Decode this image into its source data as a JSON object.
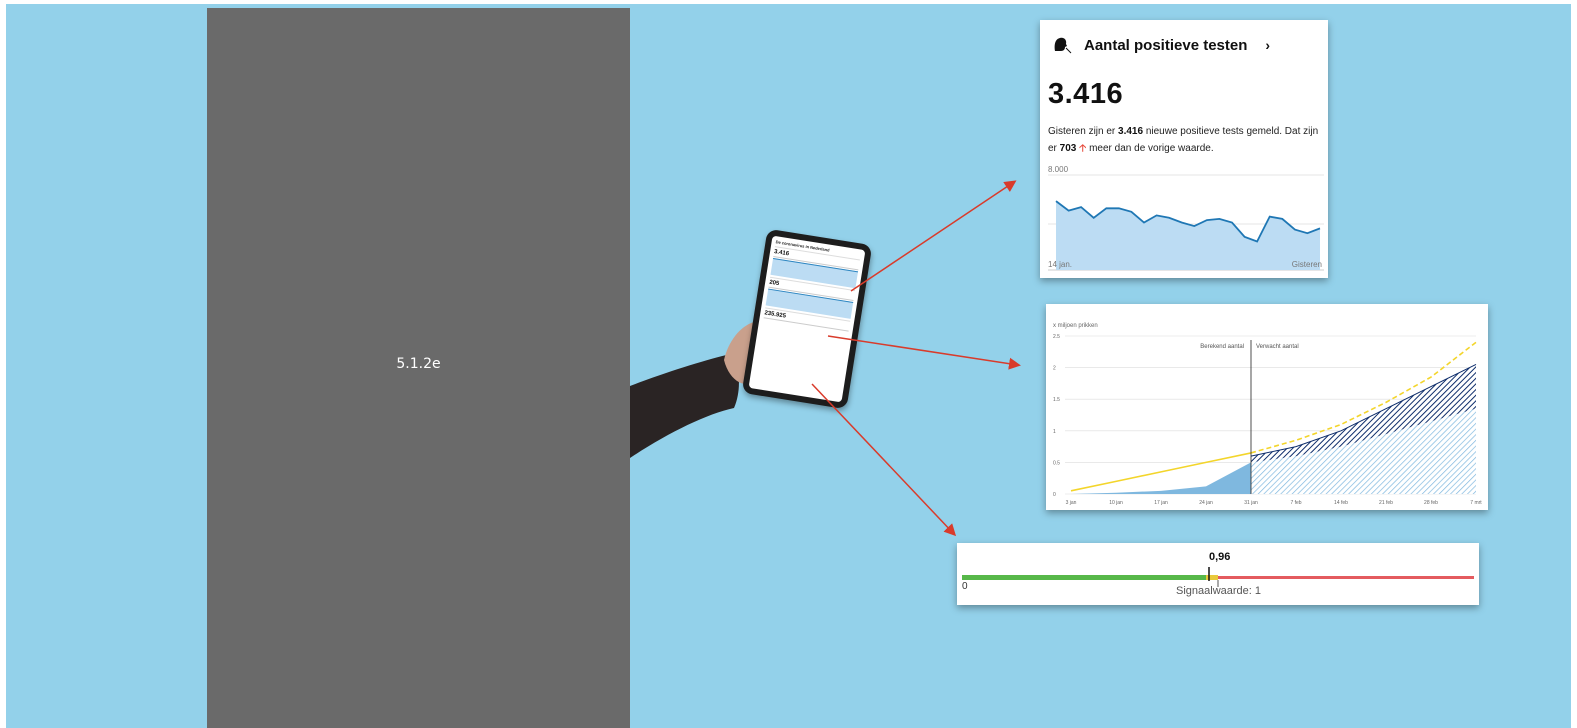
{
  "placeholder": {
    "label": "5.1.2e"
  },
  "tablet": {
    "title": "De coronavirus in Nederland",
    "section1_value": "3.416",
    "section2_value": "205",
    "section3_value": "235.925"
  },
  "card_positive_tests": {
    "icon": "person-coughing-icon",
    "title": "Aantal positieve testen",
    "chevron": "›",
    "value": "3.416",
    "desc_pre": "Gisteren zijn er ",
    "desc_value": "3.416",
    "desc_mid": " nieuwe positieve tests gemeld. Dat zijn er ",
    "desc_diff": "703",
    "desc_post": " meer dan de vorige waarde.",
    "arrow_color": "#e64b3c",
    "chart_data": {
      "type": "area",
      "title": "",
      "ytick": "8.000",
      "x_start_label": "14 jan.",
      "x_end_label": "Gisteren",
      "ylim": [
        0,
        8000
      ],
      "values": [
        5800,
        5000,
        5300,
        4400,
        5200,
        5200,
        4900,
        4000,
        4600,
        4400,
        4000,
        3700,
        4200,
        4300,
        4000,
        2800,
        2400,
        4500,
        4300,
        3400,
        3100,
        3500
      ],
      "line_color": "#1f77b4",
      "fill_color": "#bcdcf3"
    }
  },
  "card_vaccinations": {
    "ylabel": "x miljoen prikken",
    "label_calculated": "Berekend aantal",
    "label_expected": "Verwacht aantal",
    "chart_data": {
      "type": "line",
      "ylabel": "x miljoen prikken",
      "yticks": [
        "0",
        "0.5",
        "1",
        "1.5",
        "2",
        "2.5"
      ],
      "ylim": [
        0,
        2.5
      ],
      "xticks": [
        "3 jan",
        "10 jan",
        "17 jan",
        "24 jan",
        "31 jan",
        "7 feb",
        "14 feb",
        "21 feb",
        "28 feb",
        "7 mrt"
      ],
      "series": [
        {
          "name": "",
          "values": [
            0.05,
            0.2,
            0.35,
            0.5,
            0.65,
            0.85,
            1.1,
            1.45,
            1.85,
            2.4
          ]
        },
        {
          "name": "",
          "values": [
            0.0,
            0.03,
            0.07,
            0.15,
            0.6,
            0.75,
            1.0,
            1.35,
            1.7,
            2.05
          ]
        },
        {
          "name": "",
          "values": [
            0.0,
            0.02,
            0.05,
            0.12,
            0.5,
            0.6,
            0.75,
            0.95,
            1.15,
            1.35
          ]
        }
      ],
      "divider_at": "31 jan",
      "colors": {
        "yellow": "#f3d52b",
        "dark": "#0e2d6b",
        "light": "#7fb8df"
      }
    }
  },
  "card_reproduction": {
    "value": "0,96",
    "min_label": "0",
    "signal_label": "Signaalwaarde: 1",
    "chart_data": {
      "type": "bar",
      "value": 0.96,
      "signal": 1,
      "colors": {
        "green": "#57b849",
        "yellow": "#e8c93b",
        "red": "#e45b5f"
      }
    }
  }
}
